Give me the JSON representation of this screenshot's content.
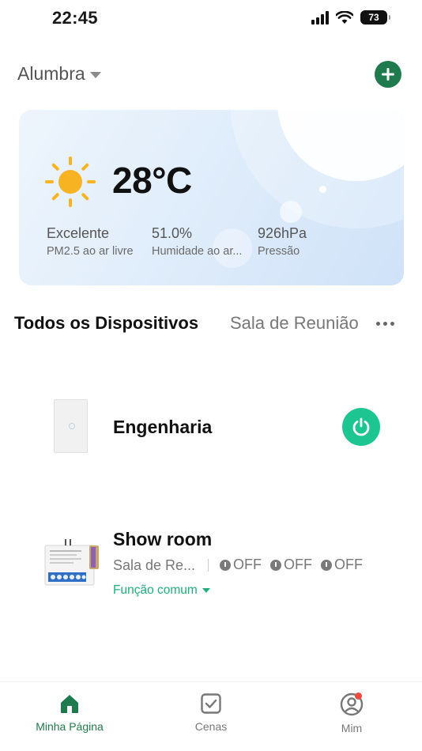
{
  "status_bar": {
    "time": "22:45",
    "battery": "73"
  },
  "header": {
    "home_name": "Alumbra"
  },
  "weather": {
    "temperature": "28°C",
    "metrics": [
      {
        "value": "Excelente",
        "label": "PM2.5 ao ar livre"
      },
      {
        "value": "51.0%",
        "label": "Humidade ao ar..."
      },
      {
        "value": "926hPa",
        "label": "Pressão"
      }
    ]
  },
  "tabs": {
    "active": "Todos os Dispositivos",
    "other": "Sala de Reunião"
  },
  "devices": [
    {
      "name": "Engenharia",
      "power_on": true
    },
    {
      "name": "Show room",
      "room": "Sala de Re...",
      "channels": [
        "OFF",
        "OFF",
        "OFF"
      ],
      "function_label": "Função comum"
    }
  ],
  "nav": {
    "items": [
      {
        "label": "Minha Página",
        "icon": "home-icon",
        "active": true
      },
      {
        "label": "Cenas",
        "icon": "scenes-icon",
        "active": false
      },
      {
        "label": "Mim",
        "icon": "profile-icon",
        "active": false
      }
    ]
  },
  "colors": {
    "accent": "#1f7a4d",
    "power_on": "#1dc691",
    "link": "#1fae7a",
    "badge": "#f04a3c"
  }
}
